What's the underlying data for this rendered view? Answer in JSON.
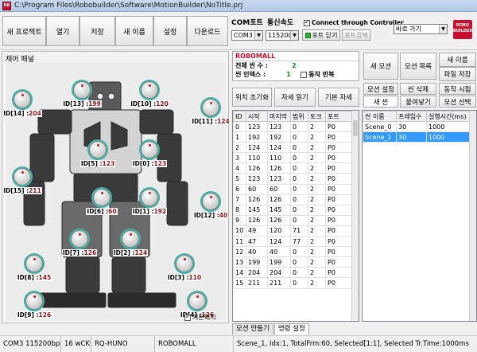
{
  "window": {
    "title": "C:\\Program Files\\Robobuilder\\Software\\MotionBuilder\\NoTitle.prj"
  },
  "toolbar": {
    "new_project": "새 프로젝트",
    "open": "열기",
    "save": "저장",
    "save_as": "새 이름",
    "settings": "설정",
    "download": "다운로드"
  },
  "com": {
    "port_label": "COM포트",
    "baud_label": "통신속도",
    "port_value": "COM3",
    "baud_value": "115200",
    "connect_label": "Connect through Controller",
    "port_close": "포트 닫기",
    "port_search": "포트검색",
    "goto_value": "바로 가기"
  },
  "logo_text": "ROBO BUILDER",
  "control_panel": {
    "title": "제어 패널",
    "basic_posture": "기본패치"
  },
  "joints": [
    {
      "id": "ID[13] :",
      "value": "199"
    },
    {
      "id": "ID[10] :",
      "value": "120"
    },
    {
      "id": "ID[14] :",
      "value": "204"
    },
    {
      "id": "ID[11] :",
      "value": "124"
    },
    {
      "id": "ID[5] :",
      "value": "123"
    },
    {
      "id": "ID[0] :",
      "value": "123"
    },
    {
      "id": "ID[15] :",
      "value": "211"
    },
    {
      "id": "ID[12] :",
      "value": "40"
    },
    {
      "id": "ID[6] :",
      "value": "60"
    },
    {
      "id": "ID[1] :",
      "value": "192"
    },
    {
      "id": "ID[7] :",
      "value": "126"
    },
    {
      "id": "ID[2] :",
      "value": "124"
    },
    {
      "id": "ID[8] :",
      "value": "145"
    },
    {
      "id": "ID[3] :",
      "value": "110"
    },
    {
      "id": "ID[9] :",
      "value": "126"
    },
    {
      "id": "ID[4] :",
      "value": "126"
    }
  ],
  "info": {
    "title": "ROBOMALL",
    "total_scenes_label": "전체 씬 수 :",
    "total_scenes": "2",
    "scene_index_label": "씬 인덱스 :",
    "scene_index": "1",
    "loop_label": "동작 반복"
  },
  "mid_buttons": {
    "init_pos": "위치 초기화",
    "read_pose": "자세 읽기",
    "basic_pose": "기본 자세"
  },
  "right_buttons": {
    "new_motion": "새 모션",
    "motion_list": "모션 목록",
    "rename": "새 이름",
    "file_save": "파일 저장",
    "motion_settings": "모션 설정",
    "delete_scene": "씬 삭제",
    "motion_test": "동작 시험",
    "new_scene": "새 씬",
    "paste": "붙여넣기",
    "select_motion": "모션 선택"
  },
  "joint_table": {
    "headers": [
      "ID",
      "시작",
      "마지막",
      "범위",
      "토크",
      "포트"
    ],
    "rows": [
      [
        "0",
        "123",
        "123",
        "0",
        "2",
        "P0"
      ],
      [
        "1",
        "192",
        "192",
        "0",
        "2",
        "P0"
      ],
      [
        "2",
        "124",
        "124",
        "0",
        "2",
        "P0"
      ],
      [
        "3",
        "110",
        "110",
        "0",
        "2",
        "P0"
      ],
      [
        "4",
        "126",
        "126",
        "0",
        "2",
        "P0"
      ],
      [
        "5",
        "123",
        "123",
        "0",
        "2",
        "P0"
      ],
      [
        "6",
        "60",
        "60",
        "0",
        "2",
        "P0"
      ],
      [
        "7",
        "126",
        "126",
        "0",
        "2",
        "P0"
      ],
      [
        "8",
        "145",
        "145",
        "0",
        "2",
        "P0"
      ],
      [
        "9",
        "126",
        "126",
        "0",
        "2",
        "P0"
      ],
      [
        "10",
        "49",
        "120",
        "71",
        "2",
        "P0"
      ],
      [
        "11",
        "47",
        "124",
        "77",
        "2",
        "P0"
      ],
      [
        "12",
        "40",
        "40",
        "0",
        "2",
        "P0"
      ],
      [
        "13",
        "199",
        "199",
        "0",
        "2",
        "P0"
      ],
      [
        "14",
        "204",
        "204",
        "0",
        "2",
        "P0"
      ],
      [
        "15",
        "211",
        "211",
        "0",
        "2",
        "P0"
      ]
    ]
  },
  "scene_table": {
    "headers": [
      "씬 이름",
      "프레임수",
      "실행시간(ms)"
    ],
    "rows": [
      [
        "Scene_0",
        "30",
        "1000"
      ],
      [
        "Scene_1",
        "30",
        "1000"
      ]
    ],
    "selected_index": 1
  },
  "tabs": [
    "모션 만들기",
    "명령 설정"
  ],
  "status": {
    "connection": "COM3 115200bps",
    "wcks": "16 wCKs",
    "model": "RQ-HUNO",
    "name": "ROBOMALL",
    "detail": "Scene_1, Idx:1, TotalFrm:60, Selected[1:1], Selected Tr.Time:1000ms"
  },
  "colors": {
    "accent": "#c8102e",
    "selection": "#3399ff",
    "knob_ring": "#3fb3a8"
  }
}
